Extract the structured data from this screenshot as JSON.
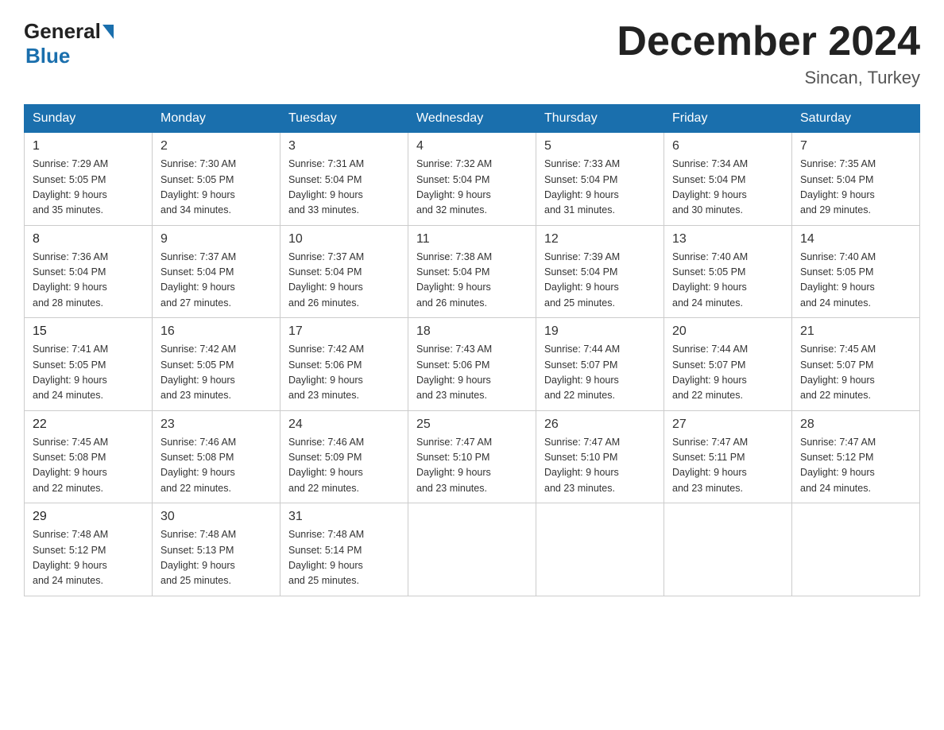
{
  "logo": {
    "general": "General",
    "blue": "Blue"
  },
  "title": "December 2024",
  "subtitle": "Sincan, Turkey",
  "days_of_week": [
    "Sunday",
    "Monday",
    "Tuesday",
    "Wednesday",
    "Thursday",
    "Friday",
    "Saturday"
  ],
  "weeks": [
    [
      {
        "num": "1",
        "sunrise": "7:29 AM",
        "sunset": "5:05 PM",
        "daylight": "9 hours and 35 minutes."
      },
      {
        "num": "2",
        "sunrise": "7:30 AM",
        "sunset": "5:05 PM",
        "daylight": "9 hours and 34 minutes."
      },
      {
        "num": "3",
        "sunrise": "7:31 AM",
        "sunset": "5:04 PM",
        "daylight": "9 hours and 33 minutes."
      },
      {
        "num": "4",
        "sunrise": "7:32 AM",
        "sunset": "5:04 PM",
        "daylight": "9 hours and 32 minutes."
      },
      {
        "num": "5",
        "sunrise": "7:33 AM",
        "sunset": "5:04 PM",
        "daylight": "9 hours and 31 minutes."
      },
      {
        "num": "6",
        "sunrise": "7:34 AM",
        "sunset": "5:04 PM",
        "daylight": "9 hours and 30 minutes."
      },
      {
        "num": "7",
        "sunrise": "7:35 AM",
        "sunset": "5:04 PM",
        "daylight": "9 hours and 29 minutes."
      }
    ],
    [
      {
        "num": "8",
        "sunrise": "7:36 AM",
        "sunset": "5:04 PM",
        "daylight": "9 hours and 28 minutes."
      },
      {
        "num": "9",
        "sunrise": "7:37 AM",
        "sunset": "5:04 PM",
        "daylight": "9 hours and 27 minutes."
      },
      {
        "num": "10",
        "sunrise": "7:37 AM",
        "sunset": "5:04 PM",
        "daylight": "9 hours and 26 minutes."
      },
      {
        "num": "11",
        "sunrise": "7:38 AM",
        "sunset": "5:04 PM",
        "daylight": "9 hours and 26 minutes."
      },
      {
        "num": "12",
        "sunrise": "7:39 AM",
        "sunset": "5:04 PM",
        "daylight": "9 hours and 25 minutes."
      },
      {
        "num": "13",
        "sunrise": "7:40 AM",
        "sunset": "5:05 PM",
        "daylight": "9 hours and 24 minutes."
      },
      {
        "num": "14",
        "sunrise": "7:40 AM",
        "sunset": "5:05 PM",
        "daylight": "9 hours and 24 minutes."
      }
    ],
    [
      {
        "num": "15",
        "sunrise": "7:41 AM",
        "sunset": "5:05 PM",
        "daylight": "9 hours and 24 minutes."
      },
      {
        "num": "16",
        "sunrise": "7:42 AM",
        "sunset": "5:05 PM",
        "daylight": "9 hours and 23 minutes."
      },
      {
        "num": "17",
        "sunrise": "7:42 AM",
        "sunset": "5:06 PM",
        "daylight": "9 hours and 23 minutes."
      },
      {
        "num": "18",
        "sunrise": "7:43 AM",
        "sunset": "5:06 PM",
        "daylight": "9 hours and 23 minutes."
      },
      {
        "num": "19",
        "sunrise": "7:44 AM",
        "sunset": "5:07 PM",
        "daylight": "9 hours and 22 minutes."
      },
      {
        "num": "20",
        "sunrise": "7:44 AM",
        "sunset": "5:07 PM",
        "daylight": "9 hours and 22 minutes."
      },
      {
        "num": "21",
        "sunrise": "7:45 AM",
        "sunset": "5:07 PM",
        "daylight": "9 hours and 22 minutes."
      }
    ],
    [
      {
        "num": "22",
        "sunrise": "7:45 AM",
        "sunset": "5:08 PM",
        "daylight": "9 hours and 22 minutes."
      },
      {
        "num": "23",
        "sunrise": "7:46 AM",
        "sunset": "5:08 PM",
        "daylight": "9 hours and 22 minutes."
      },
      {
        "num": "24",
        "sunrise": "7:46 AM",
        "sunset": "5:09 PM",
        "daylight": "9 hours and 22 minutes."
      },
      {
        "num": "25",
        "sunrise": "7:47 AM",
        "sunset": "5:10 PM",
        "daylight": "9 hours and 23 minutes."
      },
      {
        "num": "26",
        "sunrise": "7:47 AM",
        "sunset": "5:10 PM",
        "daylight": "9 hours and 23 minutes."
      },
      {
        "num": "27",
        "sunrise": "7:47 AM",
        "sunset": "5:11 PM",
        "daylight": "9 hours and 23 minutes."
      },
      {
        "num": "28",
        "sunrise": "7:47 AM",
        "sunset": "5:12 PM",
        "daylight": "9 hours and 24 minutes."
      }
    ],
    [
      {
        "num": "29",
        "sunrise": "7:48 AM",
        "sunset": "5:12 PM",
        "daylight": "9 hours and 24 minutes."
      },
      {
        "num": "30",
        "sunrise": "7:48 AM",
        "sunset": "5:13 PM",
        "daylight": "9 hours and 25 minutes."
      },
      {
        "num": "31",
        "sunrise": "7:48 AM",
        "sunset": "5:14 PM",
        "daylight": "9 hours and 25 minutes."
      },
      null,
      null,
      null,
      null
    ]
  ],
  "labels": {
    "sunrise": "Sunrise:",
    "sunset": "Sunset:",
    "daylight": "Daylight:"
  }
}
